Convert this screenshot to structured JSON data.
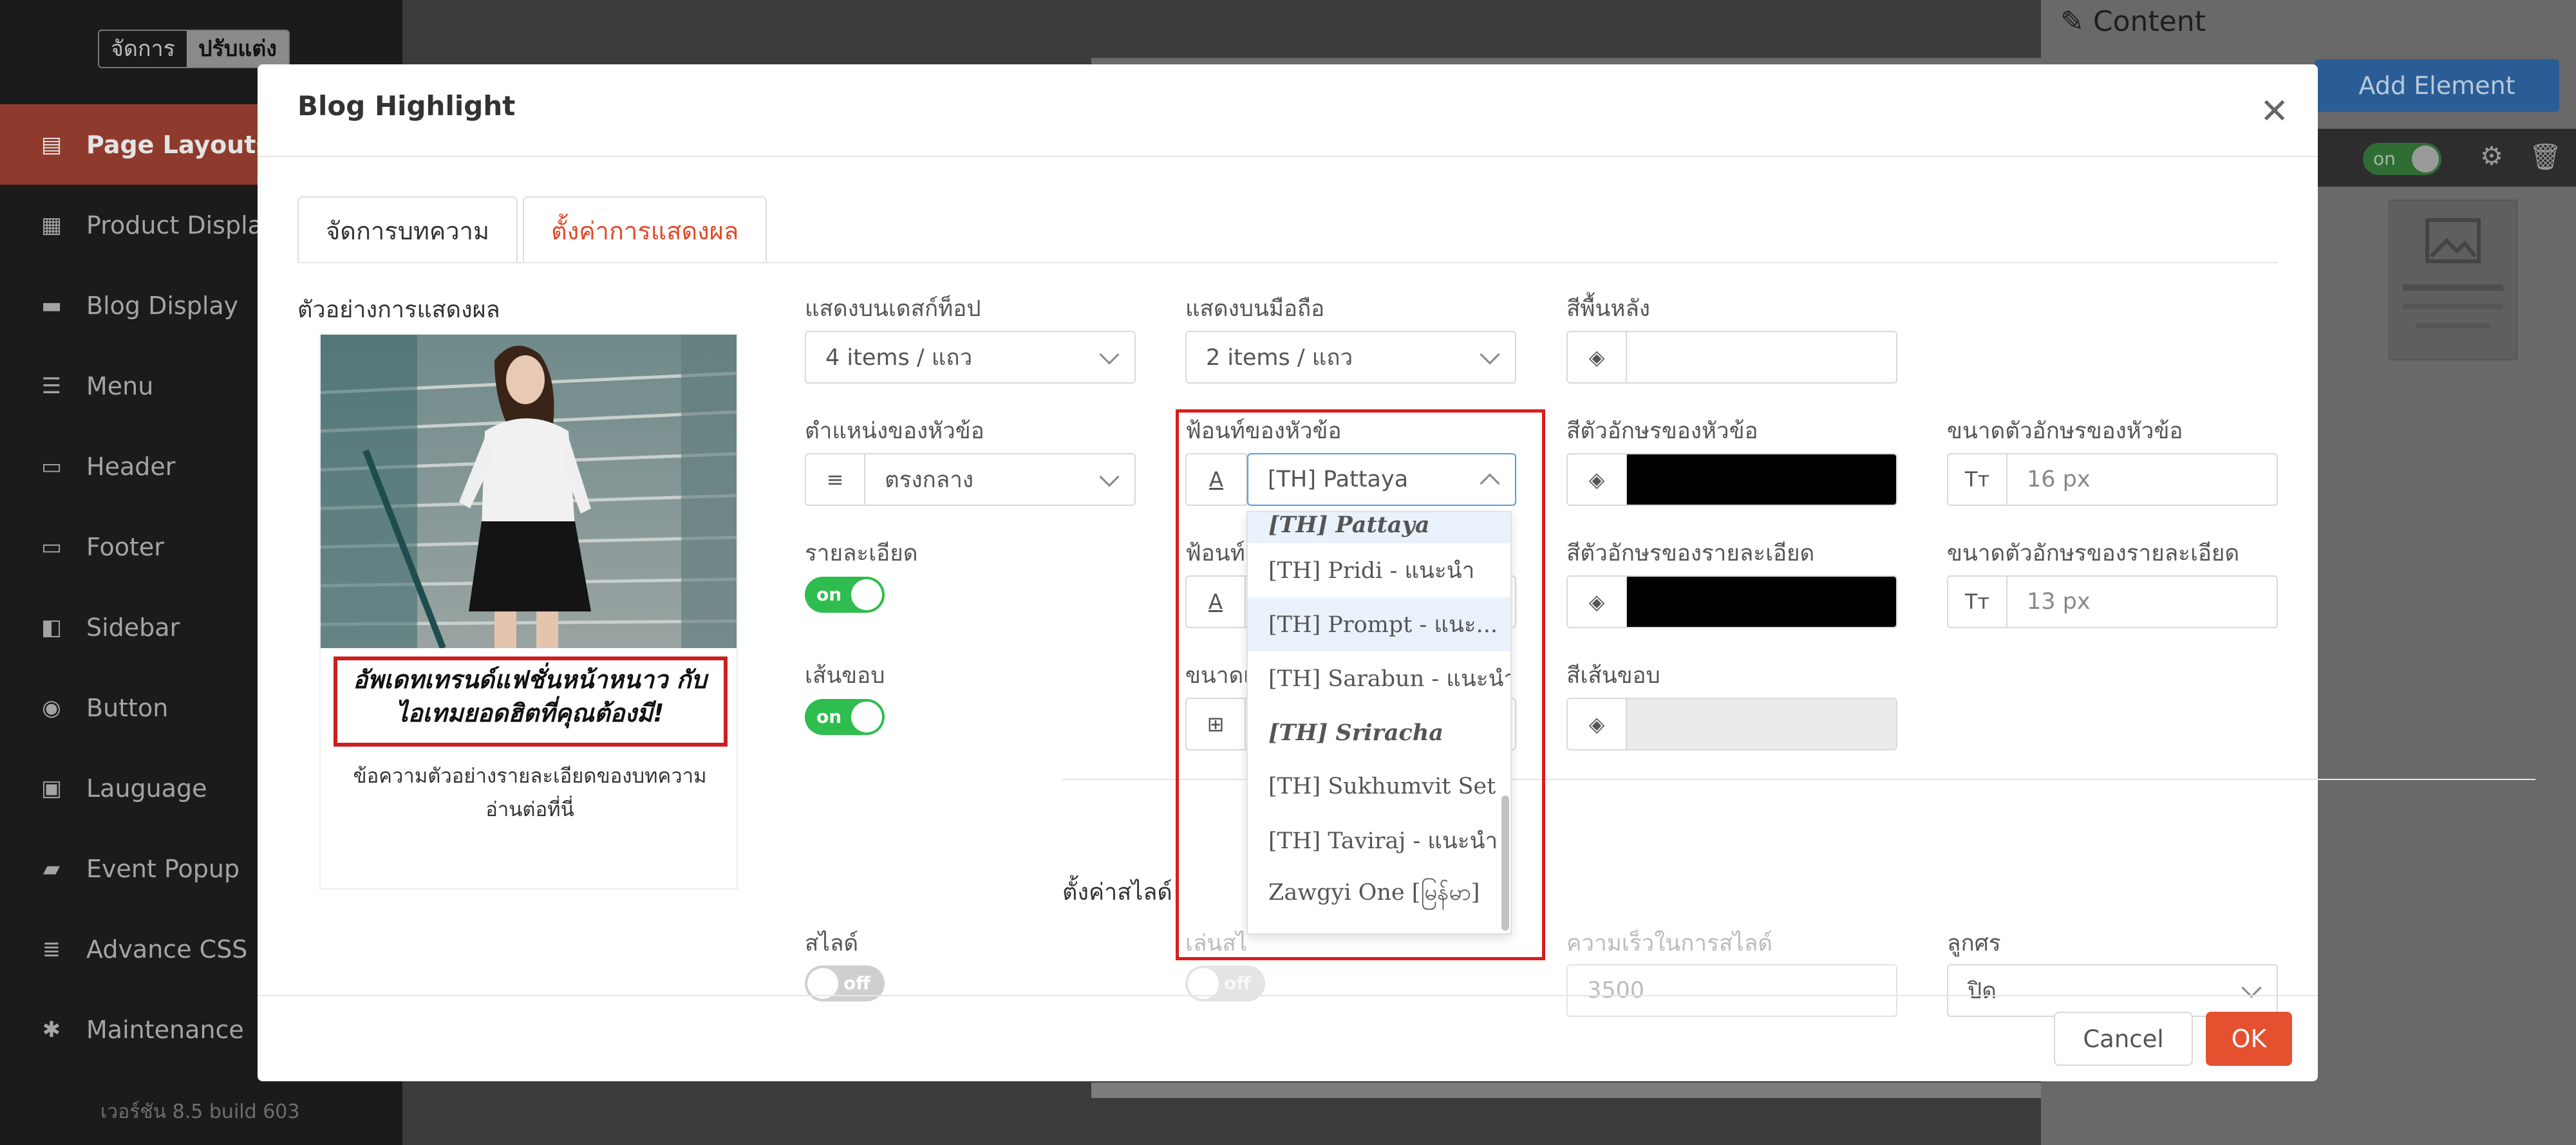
{
  "background": {
    "mode_switch": {
      "manage": "จัดการ",
      "customize": "ปรับแต่ง"
    },
    "sidebar_items": [
      {
        "label": "Page Layouts",
        "icon": "page-layout-icon"
      },
      {
        "label": "Product Display",
        "icon": "grid-icon"
      },
      {
        "label": "Blog Display",
        "icon": "blog-icon"
      },
      {
        "label": "Menu",
        "icon": "menu-icon"
      },
      {
        "label": "Header",
        "icon": "header-icon"
      },
      {
        "label": "Footer",
        "icon": "footer-icon"
      },
      {
        "label": "Sidebar",
        "icon": "sidebar-icon"
      },
      {
        "label": "Button",
        "icon": "toggle-icon"
      },
      {
        "label": "Lauguage",
        "icon": "language-icon"
      },
      {
        "label": "Event Popup",
        "icon": "ticket-icon"
      },
      {
        "label": "Advance CSS",
        "icon": "css-icon"
      },
      {
        "label": "Maintenance",
        "icon": "bug-icon"
      }
    ],
    "version": "เวอร์ชัน 8.5 build 603",
    "right_panel": {
      "title": "Content",
      "add_button": "Add Element",
      "toggle": "on"
    }
  },
  "modal": {
    "title": "Blog Highlight",
    "tabs": [
      {
        "label": "จัดการบทความ",
        "active": false
      },
      {
        "label": "ตั้งค่าการแสดงผล",
        "active": true
      }
    ],
    "preview": {
      "title": "ตัวอย่างการแสดงผล",
      "headline": "อัพเดทเทรนด์แฟชั่นหน้าหนาว กับไอเทมยอดฮิตที่คุณต้องมี!",
      "description": "ข้อความตัวอย่างรายละเอียดของบทความอ่านต่อที่นี่"
    },
    "fields": {
      "desktop": {
        "label": "แสดงบนเดสก์ท็อป",
        "value": "4 items / แถว"
      },
      "mobile": {
        "label": "แสดงบนมือถือ",
        "value": "2 items / แถว"
      },
      "bg_color": {
        "label": "สีพื้นหลัง"
      },
      "heading_pos": {
        "label": "ตำแหน่งของหัวข้อ",
        "value": "ตรงกลาง"
      },
      "heading_font": {
        "label": "ฟ้อนท์ของหัวข้อ",
        "value": "[TH] Pattaya"
      },
      "heading_color": {
        "label": "สีตัวอักษรของหัวข้อ",
        "color": "#000000"
      },
      "heading_size": {
        "label": "ขนาดตัวอักษรของหัวข้อ",
        "value": "16 px"
      },
      "detail": {
        "label": "รายละเอียด",
        "toggle": "on"
      },
      "detail_font": {
        "label": "ฟ้อนท์"
      },
      "detail_color": {
        "label": "สีตัวอักษรของรายละเอียด",
        "color": "#000000"
      },
      "detail_size": {
        "label": "ขนาดตัวอักษรของรายละเอียด",
        "value": "13 px"
      },
      "border": {
        "label": "เส้นขอบ",
        "toggle": "on"
      },
      "border_size": {
        "label": "ขนาดเ"
      },
      "border_color": {
        "label": "สีเส้นขอบ"
      }
    },
    "slide_section": {
      "title": "ตั้งค่าสไลด์",
      "slide": {
        "label": "สไลด์",
        "toggle": "off"
      },
      "autoplay": {
        "label": "เล่นสไ",
        "toggle": "off"
      },
      "speed": {
        "label": "ความเร็วในการสไลด์",
        "value": "3500"
      },
      "arrow": {
        "label": "ลูกศร",
        "value": "ปิด"
      }
    },
    "font_dropdown": {
      "options": [
        "[TH] Pattaya",
        "[TH] Pridi - แนะนำ",
        "[TH] Prompt - แนะ...",
        "[TH] Sarabun - แนะนำ",
        "[TH] Sriracha",
        "[TH] Sukhumvit Set",
        "[TH] Taviraj - แนะนำ",
        "Zawgyi One [မြန်မာ]"
      ]
    },
    "footer": {
      "cancel": "Cancel",
      "ok": "OK"
    },
    "colors": {
      "accent": "#e5512f",
      "switch_on": "#2ebd4e",
      "highlight_frame": "#d71e1e"
    }
  }
}
